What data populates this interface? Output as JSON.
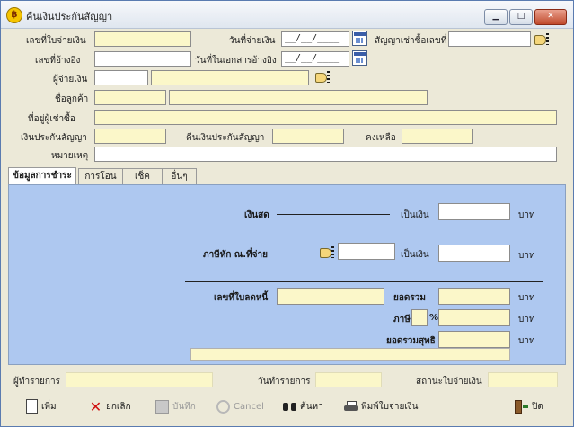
{
  "window": {
    "title": "คืนเงินประกันสัญญา",
    "app_icon": "฿",
    "min_label": "▁",
    "max_label": "□",
    "close_label": "✕"
  },
  "form": {
    "receipt_no_label": "เลขที่ใบจ่ายเงิน",
    "pay_date_label": "วันที่จ่ายเงิน",
    "pay_date_value": "__/__/____",
    "contract_no_label": "สัญญาเช่าซื้อเลขที่",
    "ref_no_label": "เลขที่อ้างอิง",
    "ref_date_label": "วันที่ในเอกสารอ้างอิง",
    "ref_date_value": "__/__/____",
    "payer_label": "ผู้จ่ายเงิน",
    "customer_label": "ชื่อลูกค้า",
    "address_label": "ที่อยู่ผู้เช่าซื้อ",
    "deposit_label": "เงินประกันสัญญา",
    "refund_label": "คืนเงินประกันสัญญา",
    "remain_label": "คงเหลือ",
    "note_label": "หมายเหตุ"
  },
  "tabs": [
    "ข้อมูลการชำระ",
    "การโอน",
    "เช็ค",
    "อื่นๆ"
  ],
  "payment": {
    "cash_label": "เงินสด",
    "amount_label": "เป็นเงิน",
    "baht": "บาท",
    "wht_label": "ภาษีหัก ณ.ที่จ่าย",
    "tax_invoice_label": "เลขที่ใบลดหนี้",
    "subtotal_label": "ยอดรวม",
    "vat_label": "ภาษี",
    "percent": "%",
    "net_label": "ยอดรวมสุทธิ"
  },
  "status": {
    "operator_label": "ผู้ทำรายการ",
    "txn_date_label": "วันทำรายการ",
    "doc_status_label": "สถานะใบจ่ายเงิน"
  },
  "toolbar": {
    "add": "เพิ่ม",
    "cancel_doc": "ยกเลิก",
    "save": "บันทึก",
    "cancel": "Cancel",
    "search": "ค้นหา",
    "print": "พิมพ์ใบจ่ายเงิน",
    "close": "ปิด"
  }
}
